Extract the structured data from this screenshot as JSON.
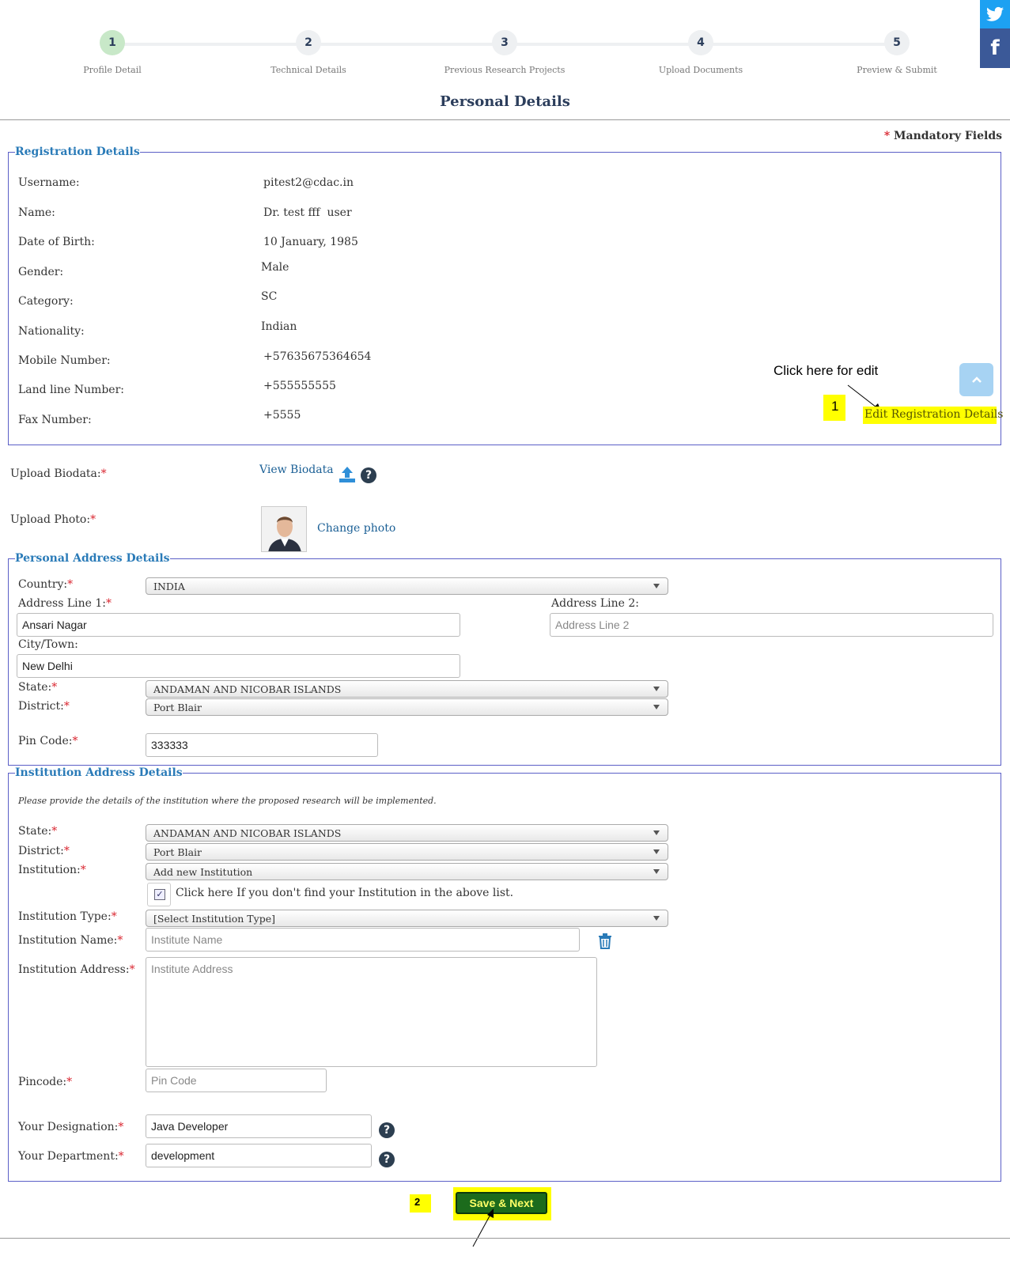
{
  "steps": [
    {
      "num": "1",
      "label": "Profile Detail"
    },
    {
      "num": "2",
      "label": "Technical Details"
    },
    {
      "num": "3",
      "label": "Previous Research Projects"
    },
    {
      "num": "4",
      "label": "Upload Documents"
    },
    {
      "num": "5",
      "label": "Preview & Submit"
    }
  ],
  "social": {
    "facebook": "f",
    "twitter_icon": "twitter-icon"
  },
  "page_title": "Personal Details",
  "mandatory": {
    "star": "*",
    "text": "Mandatory Fields"
  },
  "registration": {
    "legend": "Registration Details",
    "rows": [
      {
        "label": "Username:",
        "value": "pitest2@cdac.in"
      },
      {
        "label": "Name:",
        "value": "Dr. test fff  user"
      },
      {
        "label": "Date of Birth:",
        "value": "10 January, 1985"
      },
      {
        "label": "Gender:",
        "value": "Male"
      },
      {
        "label": "Category:",
        "value": "SC"
      },
      {
        "label": "Nationality:",
        "value": "Indian"
      },
      {
        "label": "Mobile Number:",
        "value": "+57635675364654"
      },
      {
        "label": "Land line Number:",
        "value": "+555555555"
      },
      {
        "label": "Fax Number:",
        "value": "+5555"
      }
    ],
    "edit_link": "Edit Registration Details"
  },
  "annotations": {
    "edit_hint": "Click here for edit",
    "marker1": "1",
    "marker2": "2"
  },
  "uploads": {
    "biodata_label": "Upload Biodata:",
    "biodata_link": "View Biodata",
    "photo_label": "Upload Photo:",
    "photo_link": "Change photo"
  },
  "personal_address": {
    "legend": "Personal Address Details",
    "country_label": "Country:",
    "country_value": "INDIA",
    "addr1_label": "Address Line 1:",
    "addr1_value": "Ansari Nagar",
    "addr2_label": "Address Line 2:",
    "addr2_placeholder": "Address Line 2",
    "city_label": "City/Town:",
    "city_value": "New Delhi",
    "state_label": "State:",
    "state_value": "ANDAMAN AND NICOBAR ISLANDS",
    "district_label": "District:",
    "district_value": "Port Blair",
    "pin_label": "Pin Code:",
    "pin_value": "333333"
  },
  "institution": {
    "legend": "Institution Address Details",
    "note": "Please provide the details of the institution where the proposed research will be implemented.",
    "state_label": "State:",
    "state_value": "ANDAMAN AND NICOBAR ISLANDS",
    "district_label": "District:",
    "district_value": "Port Blair",
    "institution_label": "Institution:",
    "institution_value": "Add new Institution",
    "checkbox_label": "Click here If you don't find your Institution in the above list.",
    "checkbox_checked": true,
    "type_label": "Institution Type:",
    "type_value": "[Select Institution Type]",
    "name_label": "Institution Name:",
    "name_placeholder": "Institute Name",
    "address_label": "Institution Address:",
    "address_placeholder": "Institute Address",
    "pincode_label": "Pincode:",
    "pincode_placeholder": "Pin Code",
    "designation_label": "Your Designation:",
    "designation_value": "Java Developer",
    "department_label": "Your Department:",
    "department_value": "development"
  },
  "save_button": "Save & Next",
  "colors": {
    "legend": "#2a7bb8",
    "border": "#5b5fc7",
    "link": "#1a5f95",
    "highlight": "#ffff00",
    "save": "#1c6b1c",
    "required": "#d9232d"
  }
}
